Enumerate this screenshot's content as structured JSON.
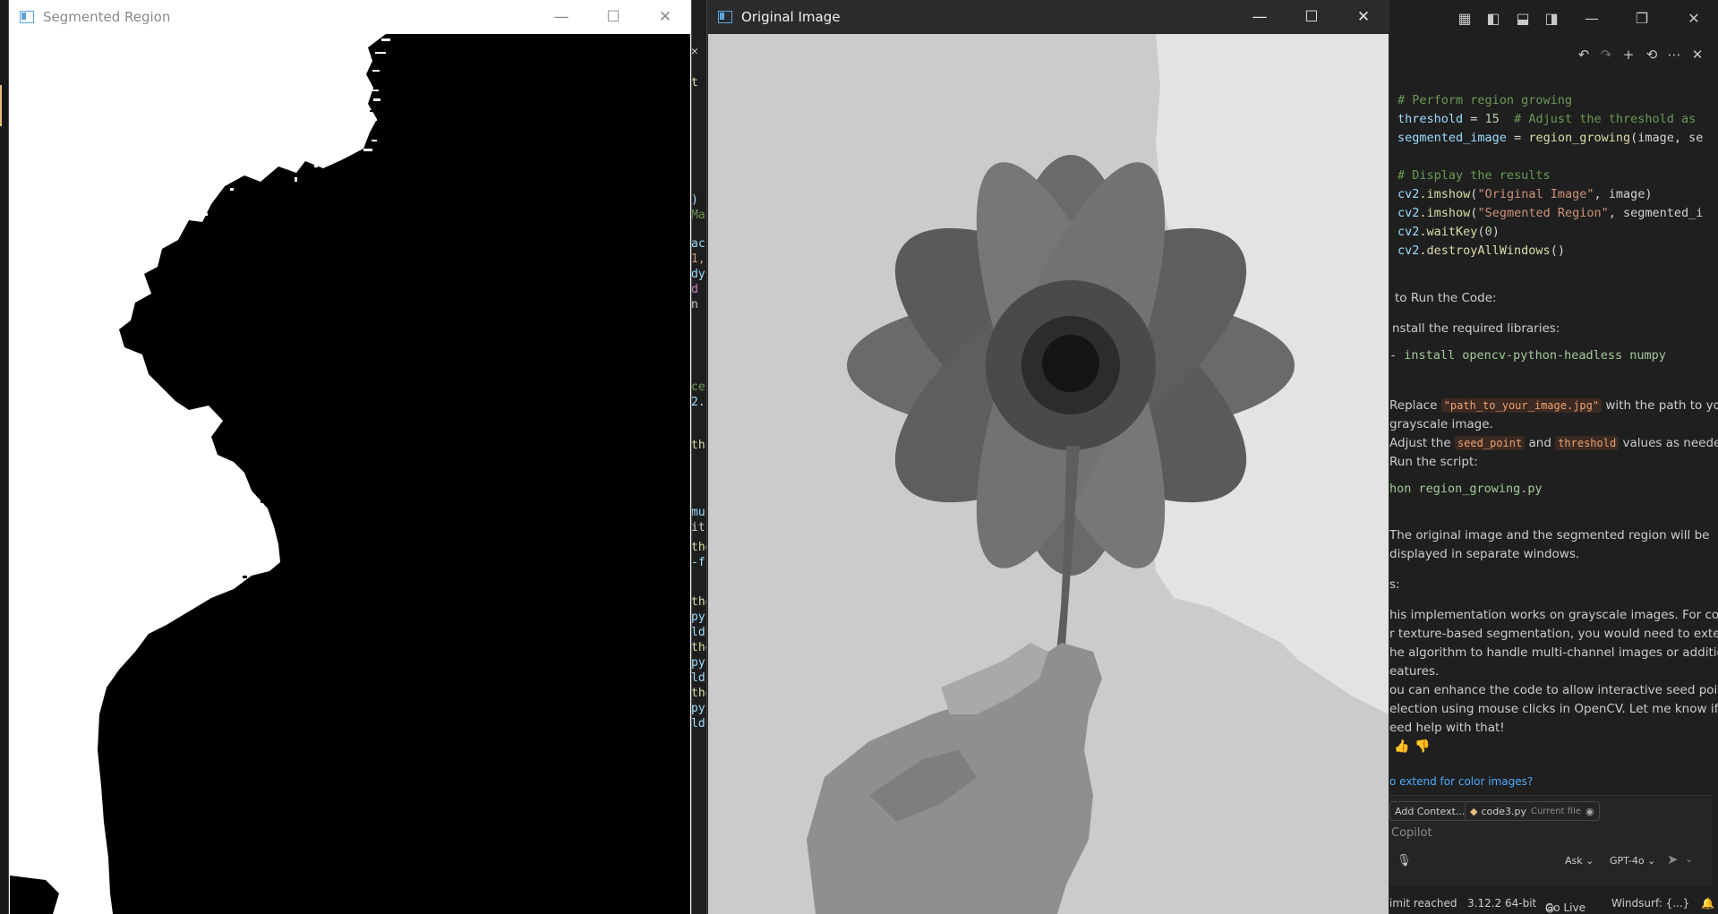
{
  "segmented_window": {
    "title": "Segmented Region"
  },
  "original_window": {
    "title": "Original Image"
  },
  "window_controls": {
    "minimize": "—",
    "maximize": "☐",
    "close": "✕"
  },
  "bg_editor": {
    "fragments": [
      "✕",
      "t",
      ")",
      "Ma",
      "ac",
      "1,",
      "dy",
      "d",
      "n",
      "ce",
      "2.",
      "th",
      "mu",
      "it",
      "tho",
      "-fi",
      "tho",
      "py:",
      "ld:",
      "tho",
      "py:",
      "ld:",
      "tho",
      "py:",
      "ld:"
    ]
  },
  "copilot": {
    "code": {
      "c1": "# Perform region growing",
      "l2_var": "threshold",
      "l2_eq": " = ",
      "l2_num": "15",
      "l2_cmt": "  # Adjust the threshold as",
      "l3_var": "segmented_image",
      "l3_eq": " = ",
      "l3_fn": "region_growing",
      "l3_rest": "(image, se",
      "c4": "# Display the results",
      "l5_mod": "cv2",
      "l5_fn": ".imshow",
      "l5_a": "(",
      "l5_str": "\"Original Image\"",
      "l5_b": ", image)",
      "l6_mod": "cv2",
      "l6_fn": ".imshow",
      "l6_a": "(",
      "l6_str": "\"Segmented Region\"",
      "l6_b": ", segmented_i",
      "l7_mod": "cv2",
      "l7_fn": ".waitKey",
      "l7_a": "(",
      "l7_num": "0",
      "l7_b": ")",
      "l8_mod": "cv2",
      "l8_fn": ".destroyAllWindows",
      "l8_b": "()"
    },
    "heading_run": "to Run the Code:",
    "install_libs": "nstall the required libraries:",
    "install_cmd": "install opencv-python-headless numpy",
    "replace_a": "Replace ",
    "replace_code": "\"path_to_your_image.jpg\"",
    "replace_b": " with the path to your",
    "replace_c": "grayscale image.",
    "adjust_a": "Adjust the ",
    "adjust_code1": "seed_point",
    "adjust_mid": " and ",
    "adjust_code2": "threshold",
    "adjust_b": " values as needed.",
    "run_script": "Run the script:",
    "run_cmd": "hon region_growing.py",
    "result_1": "The original image and the segmented region will be",
    "result_2": "displayed in separate windows.",
    "notes": "s:",
    "note_1": "his implementation works on grayscale images. For color",
    "note_2": "r texture-based segmentation, you would need to extend",
    "note_3": "he algorithm to handle multi-channel images or additional",
    "note_4": "eatures.",
    "note_5": "ou can enhance the code to allow interactive seed point",
    "note_6": "election using mouse clicks in OpenCV. Let me know if you",
    "note_7": "eed help with that!",
    "followup": "o extend for color images?",
    "add_context": "Add Context...",
    "file_chip": "code3.py",
    "file_chip_sub": "Current file",
    "input_placeholder": "Copilot",
    "mode": "Ask",
    "model": "GPT-4o"
  },
  "statusbar": {
    "limit": "imit reached",
    "python": "3.12.2 64-bit",
    "golive": "Go Live",
    "windsurf": "Windsurf: {...}"
  },
  "colors": {
    "accent_yellow": "#e5c07b",
    "link": "#4daafc",
    "inline_code": "#f0a070"
  }
}
